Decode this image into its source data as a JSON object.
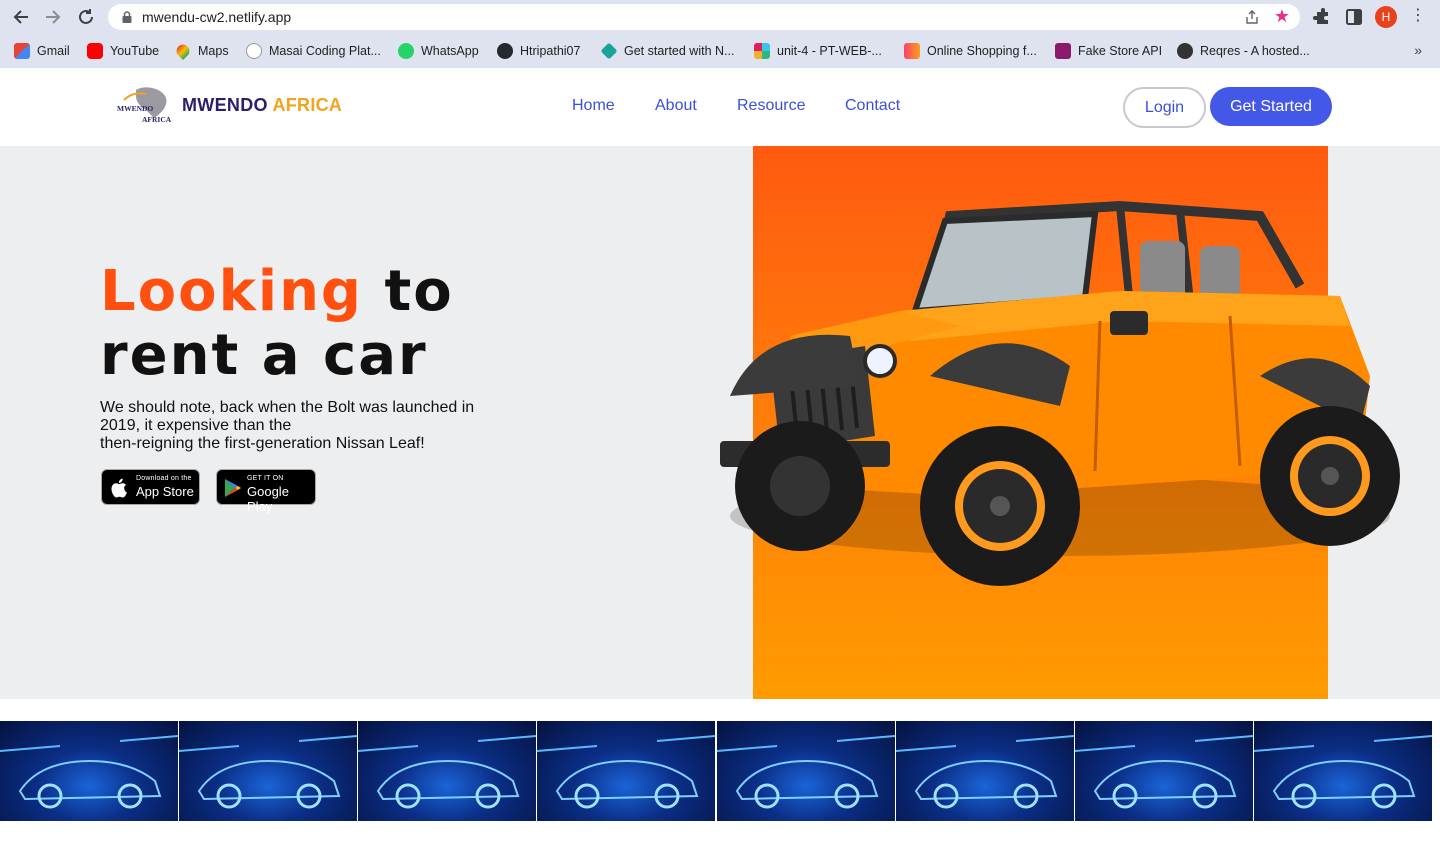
{
  "browser": {
    "url": "mwendu-cw2.netlify.app",
    "profile_initial": "H",
    "bookmarks": [
      {
        "label": "Gmail",
        "icon": "gmail-icon",
        "color": "#ea4335"
      },
      {
        "label": "YouTube",
        "icon": "youtube-icon",
        "color": "#ff0000"
      },
      {
        "label": "Maps",
        "icon": "maps-icon",
        "color": "#34a853"
      },
      {
        "label": "Masai Coding Plat...",
        "icon": "masai-icon",
        "color": "#ffffff"
      },
      {
        "label": "WhatsApp",
        "icon": "whatsapp-icon",
        "color": "#25d366"
      },
      {
        "label": "Htripathi07",
        "icon": "github-icon",
        "color": "#24292e"
      },
      {
        "label": "Get started with N...",
        "icon": "diamond-icon",
        "color": "#1aa39a"
      },
      {
        "label": "unit-4 - PT-WEB-...",
        "icon": "slack-icon",
        "color": "#e01e5a"
      },
      {
        "label": "Online Shopping f...",
        "icon": "myntra-icon",
        "color": "#ff3f6c"
      },
      {
        "label": "Fake Store API",
        "icon": "fakestore-icon",
        "color": "#8b1a6b"
      },
      {
        "label": "Reqres - A hosted...",
        "icon": "reqres-icon",
        "color": "#333333"
      }
    ]
  },
  "site": {
    "brand_part1": "MWENDO",
    "brand_part2": "AFRICA",
    "logo_text_1": "MWENDO",
    "logo_text_2": "AFRICA",
    "nav": [
      "Home",
      "About",
      "Resource",
      "Contact"
    ],
    "login_label": "Login",
    "get_started_label": "Get Started"
  },
  "hero": {
    "title_accent": "Looking",
    "title_rest_1": "to",
    "title_rest_2": "rent a car",
    "description_1": "We should note, back when the Bolt was launched in 2019, it expensive than the",
    "description_2": "then-reigning the first-generation Nissan Leaf!",
    "app_store_small": "Download on the",
    "app_store_big": "App Store",
    "google_play_small": "GET IT ON",
    "google_play_big": "Google Play"
  },
  "gallery": {
    "tile_count": 8
  },
  "colors": {
    "accent_orange": "#ff5010",
    "brand_blue": "#4358e6",
    "brand_navy": "#2a1f6b",
    "brand_gold": "#f2a21b",
    "hero_bg": "#edeef0"
  }
}
